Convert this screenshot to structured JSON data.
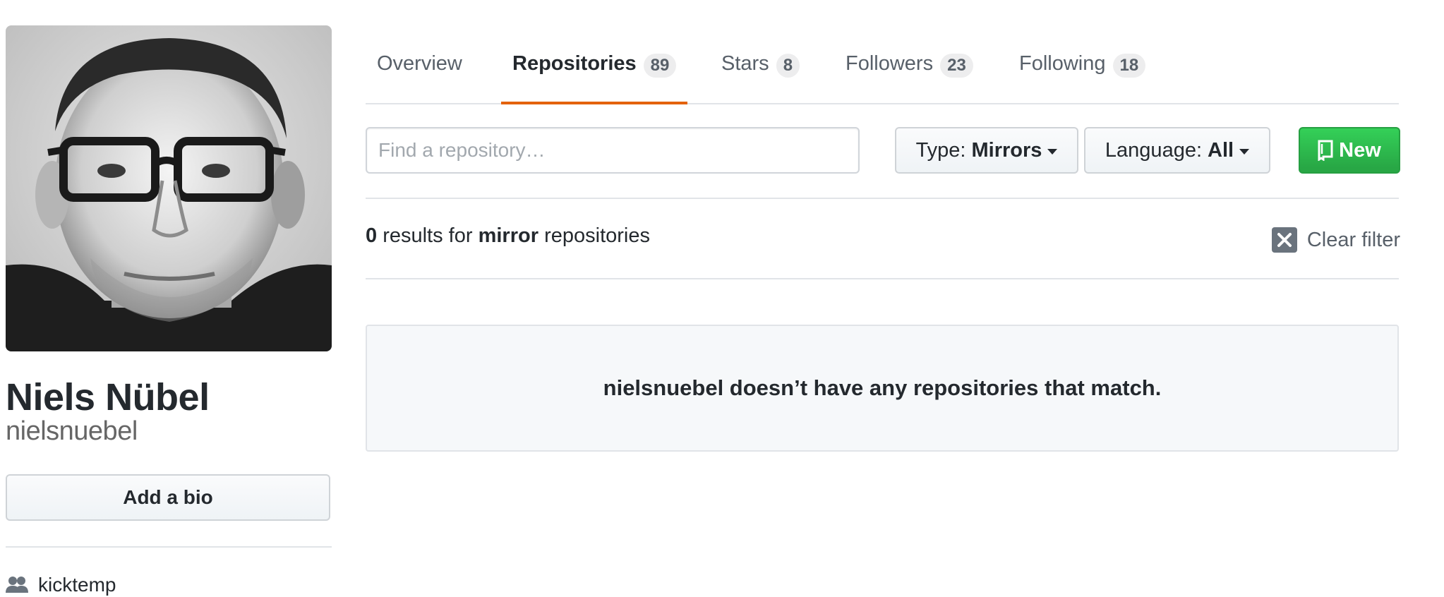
{
  "profile": {
    "full_name": "Niels Nübel",
    "username": "nielsnuebel",
    "bio_button": "Add a bio",
    "organization": "kicktemp"
  },
  "tabs": [
    {
      "label": "Overview",
      "count": null,
      "selected": false
    },
    {
      "label": "Repositories",
      "count": "89",
      "selected": true
    },
    {
      "label": "Stars",
      "count": "8",
      "selected": false
    },
    {
      "label": "Followers",
      "count": "23",
      "selected": false
    },
    {
      "label": "Following",
      "count": "18",
      "selected": false
    }
  ],
  "filters": {
    "search_placeholder": "Find a repository…",
    "type_label": "Type:",
    "type_value": "Mirrors",
    "language_label": "Language:",
    "language_value": "All",
    "new_button": "New"
  },
  "results": {
    "count": "0",
    "text_before": "results for",
    "filter_word": "mirror",
    "text_after": "repositories",
    "clear_filter": "Clear filter"
  },
  "blankslate": {
    "message": "nielsnuebel doesn’t have any repositories that match."
  },
  "colors": {
    "selected_tab_underline": "#e36209",
    "new_button": "#28a745",
    "text": "#24292e",
    "muted": "#586069"
  },
  "icons": {
    "organization": "people-icon",
    "new_repo": "repo-icon",
    "clear": "x-icon"
  }
}
